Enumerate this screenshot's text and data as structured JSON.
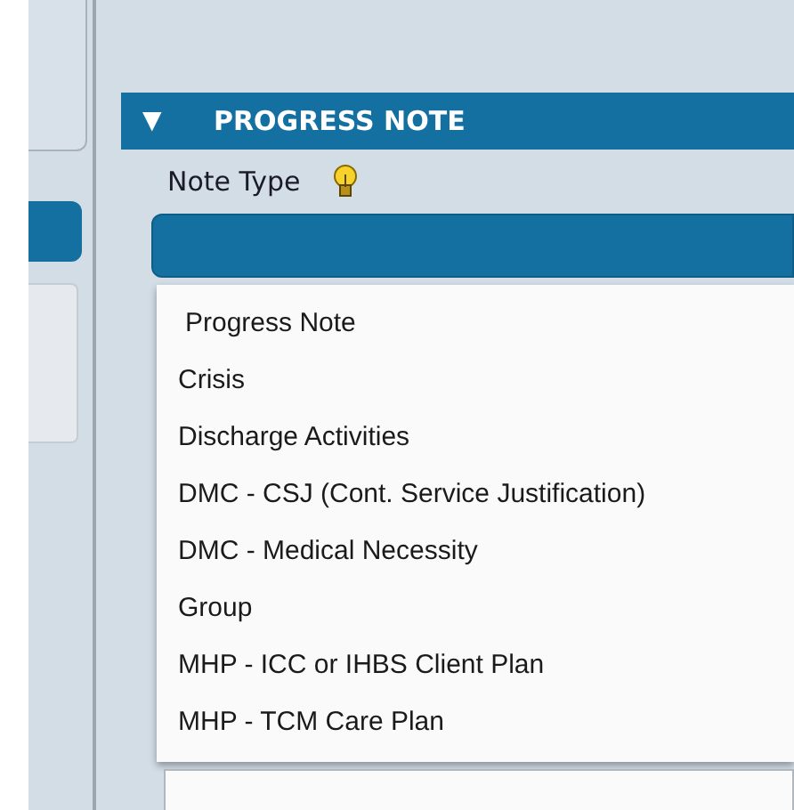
{
  "section": {
    "title": "PROGRESS NOTE",
    "toggle": "▼",
    "expanded": true
  },
  "note_type": {
    "label": "Note Type",
    "options": [
      "Progress Note",
      "Crisis",
      "Discharge Activities",
      "DMC - CSJ (Cont. Service Justification)",
      "DMC - Medical Necessity",
      "Group",
      "MHP - ICC or IHBS Client Plan",
      "MHP - TCM Care Plan"
    ]
  }
}
